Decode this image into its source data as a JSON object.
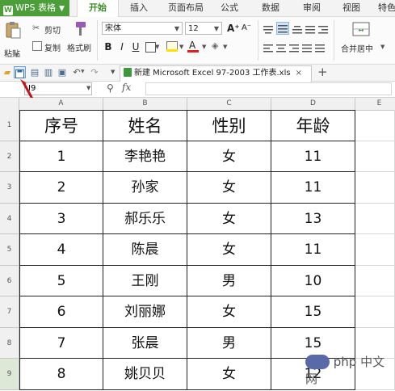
{
  "app": {
    "name": "WPS 表格"
  },
  "menu": [
    "开始",
    "插入",
    "页面布局",
    "公式",
    "数据",
    "审阅",
    "视图",
    "特色"
  ],
  "ribbon": {
    "paste": "粘贴",
    "cut": "剪切",
    "copy": "复制",
    "format_painter": "格式刷",
    "font_name": "宋体",
    "font_size": "12",
    "bold": "B",
    "italic": "I",
    "underline": "U",
    "grow_font": "A⁺",
    "shrink_font": "A⁻",
    "merge_center": "合并居中"
  },
  "document_tab": {
    "title": "新建 Microsoft Excel 97-2003 工作表.xls",
    "close": "×",
    "new": "+"
  },
  "formula_bar": {
    "name_box": "I9",
    "fx": "fx"
  },
  "columns": [
    "A",
    "B",
    "C",
    "D",
    "E"
  ],
  "rows": [
    {
      "num": "1",
      "cells": [
        "序号",
        "姓名",
        "性别",
        "年龄"
      ]
    },
    {
      "num": "2",
      "cells": [
        "1",
        "李艳艳",
        "女",
        "11"
      ]
    },
    {
      "num": "3",
      "cells": [
        "2",
        "孙家",
        "女",
        "11"
      ]
    },
    {
      "num": "4",
      "cells": [
        "3",
        "郝乐乐",
        "女",
        "13"
      ]
    },
    {
      "num": "5",
      "cells": [
        "4",
        "陈晨",
        "女",
        "11"
      ]
    },
    {
      "num": "6",
      "cells": [
        "5",
        "王刚",
        "男",
        "10"
      ]
    },
    {
      "num": "7",
      "cells": [
        "6",
        "刘丽娜",
        "女",
        "15"
      ]
    },
    {
      "num": "8",
      "cells": [
        "7",
        "张晨",
        "男",
        "15"
      ]
    },
    {
      "num": "9",
      "cells": [
        "8",
        "姚贝贝",
        "女",
        "12"
      ]
    }
  ],
  "watermark": "php 中文网",
  "colors": {
    "brand": "#4c9e3a",
    "active_tab": "#3d8c2b",
    "arrow": "#c0141a"
  }
}
